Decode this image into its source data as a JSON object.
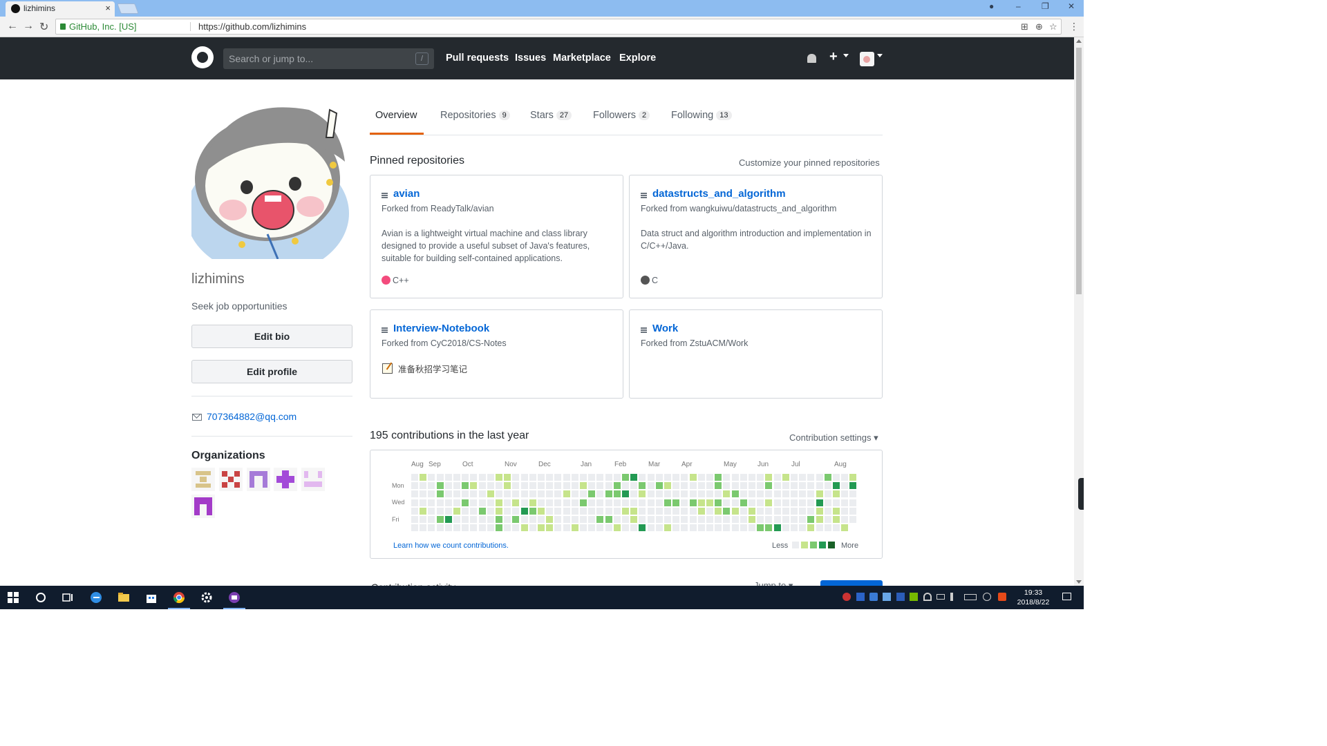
{
  "browser": {
    "tab_title": "lizhimins",
    "tab_close": "×",
    "security_label": "GitHub, Inc. [US]",
    "url": "https://github.com/lizhimins",
    "win_min": "–",
    "win_restore": "❐",
    "win_close": "✕",
    "back": "←",
    "forward": "→",
    "reload": "↻",
    "translate_icon": "⊞",
    "zoom_icon": "⊕",
    "bookmark_icon": "☆",
    "menu": "⋮"
  },
  "header": {
    "search_placeholder": "Search or jump to...",
    "search_shortcut": "/",
    "nav": [
      "Pull requests",
      "Issues",
      "Marketplace",
      "Explore"
    ],
    "plus": "+"
  },
  "profile": {
    "username": "lizhimins",
    "bio": "Seek job opportunities",
    "edit_bio": "Edit bio",
    "edit_profile": "Edit profile",
    "email": "707364882@qq.com",
    "organizations_title": "Organizations"
  },
  "tabs": [
    {
      "label": "Overview",
      "count": ""
    },
    {
      "label": "Repositories",
      "count": "9"
    },
    {
      "label": "Stars",
      "count": "27"
    },
    {
      "label": "Followers",
      "count": "2"
    },
    {
      "label": "Following",
      "count": "13"
    }
  ],
  "pinned": {
    "title": "Pinned repositories",
    "customize": "Customize your pinned repositories",
    "repos": [
      {
        "name": "avian",
        "forked": "Forked from ReadyTalk/avian",
        "desc": "Avian is a lightweight virtual machine and class library designed to provide a useful subset of Java's features, suitable for building self-contained applications.",
        "lang": "C++",
        "lang_color": "#f34b7d"
      },
      {
        "name": "datastructs_and_algorithm",
        "forked": "Forked from wangkuiwu/datastructs_and_algorithm",
        "desc": "Data struct and algorithm introduction and implementation in C/C++/Java.",
        "lang": "C",
        "lang_color": "#555555"
      },
      {
        "name": "Interview-Notebook",
        "forked": "Forked from CyC2018/CS-Notes",
        "desc": "准备秋招学习笔记",
        "lang": "",
        "lang_color": ""
      },
      {
        "name": "Work",
        "forked": "Forked from ZstuACM/Work",
        "desc": "",
        "lang": "",
        "lang_color": ""
      }
    ]
  },
  "contributions": {
    "title": "195 contributions in the last year",
    "settings": "Contribution settings ▾",
    "months": [
      "Aug",
      "Sep",
      "Oct",
      "Nov",
      "Dec",
      "Jan",
      "Feb",
      "Mar",
      "Apr",
      "May",
      "Jun",
      "Jul",
      "Aug"
    ],
    "days": [
      "Mon",
      "Wed",
      "Fri"
    ],
    "learn_link": "Learn how we count contributions.",
    "legend_less": "Less",
    "legend_more": "More",
    "colors": [
      "#ebedf0",
      "#c6e48b",
      "#7bc96f",
      "#239a53",
      "#196127"
    ],
    "weeks": 53,
    "levels": "1111200000000000000000000000000000000000000000000000000000000000000000000000000000"
  },
  "below_fold": {
    "activity_title": "Contribution activity",
    "jump_to": "Jump to ▾"
  },
  "taskbar": {
    "time": "19:33",
    "date": "2018/8/22"
  }
}
